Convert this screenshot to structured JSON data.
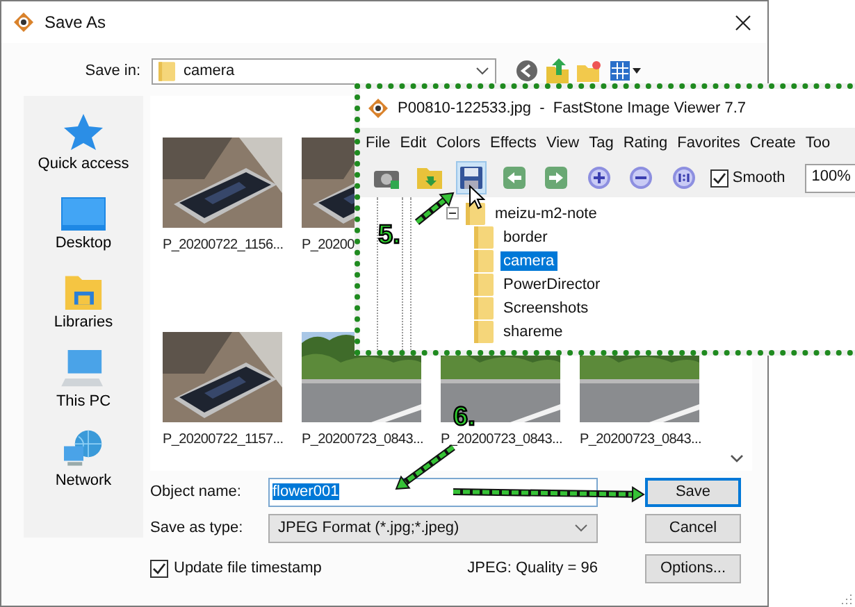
{
  "dialog": {
    "title": "Save As",
    "save_in": {
      "label": "Save in:",
      "value": "camera"
    },
    "places": [
      {
        "label": "Quick access"
      },
      {
        "label": "Desktop"
      },
      {
        "label": "Libraries"
      },
      {
        "label": "This PC"
      },
      {
        "label": "Network"
      }
    ],
    "file_rows": [
      [
        {
          "name": "P_20200722_1156..."
        },
        {
          "name": "P_20200"
        }
      ],
      [
        {
          "name": "P_20200722_1157..."
        },
        {
          "name": "P_20200723_0843..."
        },
        {
          "name": "P_20200723_0843..."
        },
        {
          "name": "P_20200723_0843..."
        }
      ]
    ],
    "object_name": {
      "label": "Object name:",
      "value": "flower001"
    },
    "save_as_type": {
      "label": "Save as type:",
      "value": "JPEG Format (*.jpg;*.jpeg)"
    },
    "update_timestamp": {
      "label": "Update file timestamp",
      "checked": true
    },
    "quality": "JPEG: Quality = 96",
    "buttons": [
      {
        "label": "Save",
        "focused": true
      },
      {
        "label": "Cancel",
        "focused": false
      },
      {
        "label": "Options...",
        "focused": false
      }
    ]
  },
  "viewer": {
    "title": "P00810-122533.jpg  -  FastStone Image Viewer 7.7",
    "menu": [
      "File",
      "Edit",
      "Colors",
      "Effects",
      "View",
      "Tag",
      "Rating",
      "Favorites",
      "Create",
      "Too"
    ],
    "tools": [
      {
        "hovered": false
      },
      {
        "hovered": false
      },
      {
        "hovered": true
      },
      {
        "hovered": false
      },
      {
        "hovered": false
      },
      {
        "hovered": false
      },
      {
        "hovered": false
      },
      {
        "hovered": false
      }
    ],
    "smooth": {
      "label": "Smooth",
      "checked": true
    },
    "zoom": "100%",
    "tree": {
      "label": "meizu-m2-note",
      "expanded": true,
      "children": [
        {
          "label": "border",
          "selected": false
        },
        {
          "label": "camera",
          "selected": true
        },
        {
          "label": "PowerDirector",
          "selected": false
        },
        {
          "label": "Screenshots",
          "selected": false
        },
        {
          "label": "shareme",
          "selected": false
        }
      ]
    }
  },
  "annotations": [
    {
      "label": "5."
    },
    {
      "label": "6."
    }
  ]
}
